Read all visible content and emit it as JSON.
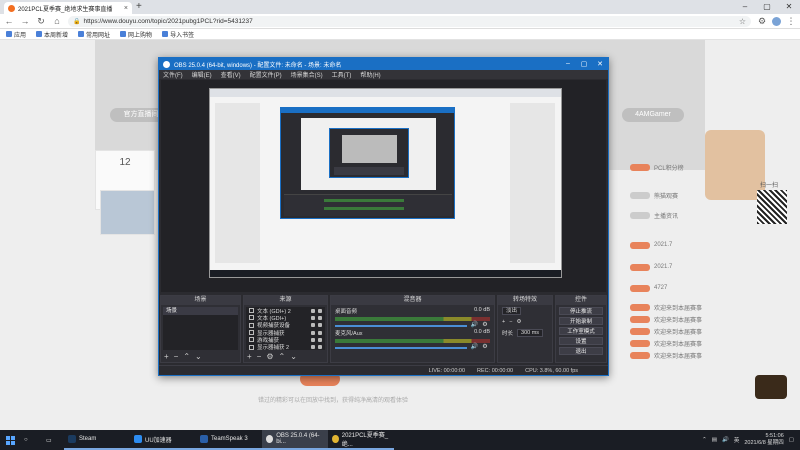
{
  "browser": {
    "tab_title": "2021PCL夏季赛_绝地求生赛事直播",
    "url": "https://www.douyu.com/topic/2021pubg1PCL?rid=5431237",
    "bookmarks": [
      "应用",
      "本周新增",
      "常用网址",
      "网上购物",
      "导入书签"
    ]
  },
  "page": {
    "left_btn": "官方直播间",
    "right_btn": "4AMGamer",
    "follow_num": "12",
    "rank_rows": [
      "PCL积分榜",
      "熊猫观赛",
      "主播资讯",
      "2021.7",
      "2021.7",
      "4727"
    ],
    "promo_rows": [
      "欢迎来到本届赛事",
      "欢迎来到本届赛事",
      "欢迎来到本届赛事",
      "欢迎来到本届赛事",
      "欢迎来到本届赛事"
    ],
    "bottom_text": "错过的精彩可以在回放中找到，获得纯净高清的观看体验",
    "side_label": "扫一扫"
  },
  "obs": {
    "title": "OBS 25.0.4 (64-bit, windows) - 配置文件: 未命名 - 场景: 未命名",
    "menu": [
      "文件(F)",
      "编辑(E)",
      "查看(V)",
      "配置文件(P)",
      "场景集合(S)",
      "工具(T)",
      "帮助(H)"
    ],
    "docks": {
      "scenes": {
        "title": "场景",
        "items": [
          "场景"
        ]
      },
      "sources": {
        "title": "来源",
        "items": [
          "文本 (GDI+) 2",
          "文本 (GDI+)",
          "视频捕获设备",
          "显示器捕获",
          "游戏捕获",
          "显示器捕获 2"
        ]
      },
      "mixer": {
        "title": "混音器",
        "channels": [
          {
            "name": "桌面音频",
            "level": "0.0 dB"
          },
          {
            "name": "麦克风/Aux",
            "level": "0.0 dB"
          }
        ]
      },
      "transitions": {
        "title": "转场特效",
        "type": "淡出",
        "duration_label": "时长",
        "duration": "300 ms"
      },
      "controls": {
        "title": "控件",
        "buttons": [
          "停止推流",
          "开始录制",
          "工作室模式",
          "设置",
          "退出"
        ]
      }
    },
    "status": {
      "live": "LIVE: 00:00:00",
      "rec": "REC: 00:00:00",
      "cpu": "CPU: 3.8%, 60.00 fps"
    }
  },
  "taskbar": {
    "apps": [
      "Steam",
      "UU加速器",
      "TeamSpeak 3",
      "OBS 25.0.4 (64-bi...",
      "2021PCL夏季赛_绝..."
    ],
    "ime": "英",
    "time": "5:51:06",
    "date": "2021/6/8 星期四"
  }
}
